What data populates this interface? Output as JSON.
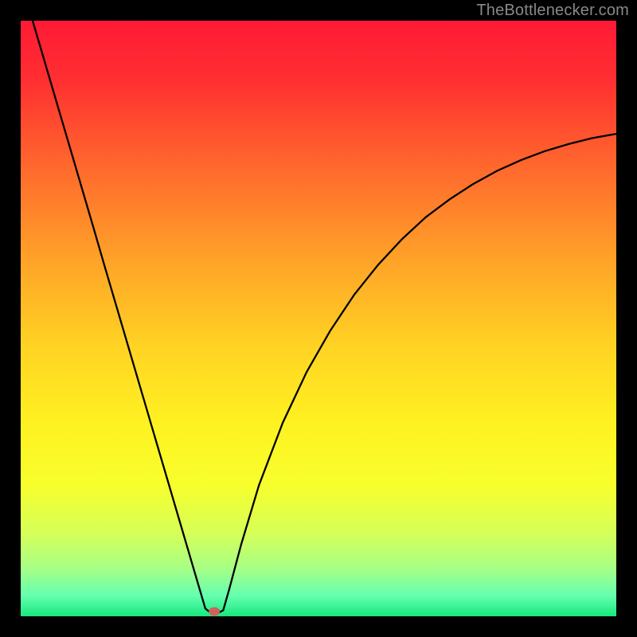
{
  "watermark": "TheBottlenecker.com",
  "chart_data": {
    "type": "line",
    "title": "",
    "xlabel": "",
    "ylabel": "",
    "xlim": [
      0,
      100
    ],
    "ylim": [
      0,
      100
    ],
    "background_gradient": {
      "stops": [
        {
          "pos": 0.0,
          "color": "#ff1a35"
        },
        {
          "pos": 0.1,
          "color": "#ff2f31"
        },
        {
          "pos": 0.25,
          "color": "#ff6a2d"
        },
        {
          "pos": 0.4,
          "color": "#ffa228"
        },
        {
          "pos": 0.55,
          "color": "#ffd423"
        },
        {
          "pos": 0.68,
          "color": "#fff221"
        },
        {
          "pos": 0.78,
          "color": "#f7ff2d"
        },
        {
          "pos": 0.86,
          "color": "#d6ff58"
        },
        {
          "pos": 0.92,
          "color": "#a6ff86"
        },
        {
          "pos": 0.965,
          "color": "#66ffb0"
        },
        {
          "pos": 1.0,
          "color": "#17e87d"
        }
      ]
    },
    "curve": {
      "x": [
        2.0,
        4.0,
        6.0,
        8.0,
        10.0,
        12.0,
        14.0,
        16.0,
        18.0,
        20.0,
        22.0,
        24.0,
        26.0,
        28.0,
        29.0,
        30.0,
        31.0,
        32.0,
        33.0,
        34.0,
        35.0,
        37.0,
        40.0,
        44.0,
        48.0,
        52.0,
        56.0,
        60.0,
        64.0,
        68.0,
        72.0,
        76.0,
        80.0,
        84.0,
        88.0,
        92.0,
        96.0,
        100.0
      ],
      "y": [
        100.0,
        93.2,
        86.4,
        79.6,
        72.8,
        66.0,
        59.1,
        52.3,
        45.5,
        38.7,
        31.9,
        25.1,
        18.3,
        11.5,
        8.1,
        4.7,
        1.3,
        0.5,
        0.5,
        1.0,
        4.5,
        12.0,
        22.0,
        32.5,
        41.0,
        48.0,
        54.0,
        59.0,
        63.3,
        67.0,
        70.0,
        72.6,
        74.8,
        76.6,
        78.1,
        79.3,
        80.3,
        81.0
      ]
    },
    "marker": {
      "x": 32.5,
      "y": 0.8,
      "color": "#d1605e"
    }
  }
}
